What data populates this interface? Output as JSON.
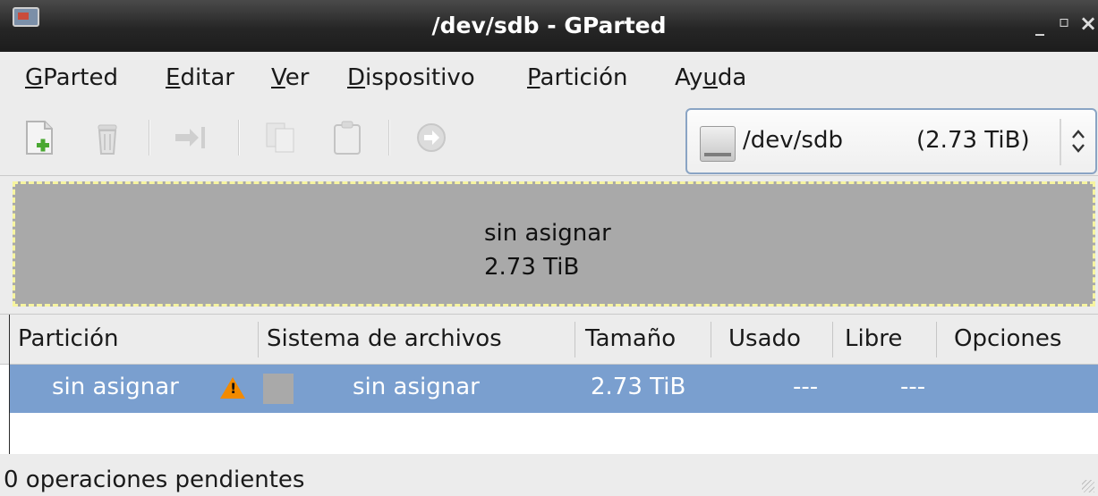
{
  "window": {
    "title": "/dev/sdb - GParted",
    "minimize_glyph": "_",
    "maximize_glyph": "▫",
    "close_glyph": "×"
  },
  "menu": [
    {
      "label": "GParted",
      "mnemonic": "G",
      "rest": "Parted"
    },
    {
      "label": "Editar",
      "mnemonic": "E",
      "rest": "ditar"
    },
    {
      "label": "Ver",
      "mnemonic": "V",
      "rest": "er"
    },
    {
      "label": "Dispositivo",
      "mnemonic": "D",
      "rest": "ispositivo"
    },
    {
      "label": "Partición",
      "mnemonic": "P",
      "rest": "artición"
    },
    {
      "label": "Ayuda",
      "pre": "Ay",
      "mnemonic": "u",
      "rest": "da"
    }
  ],
  "toolbar": {
    "icons": [
      "new-partition-icon",
      "delete-partition-icon",
      "resize-move-icon",
      "copy-icon",
      "paste-icon",
      "apply-icon"
    ],
    "device_selector": {
      "path": "/dev/sdb",
      "size": "(2.73 TiB)",
      "icon": "hard-disk-icon"
    }
  },
  "diskmap": {
    "label": "sin asignar",
    "size": "2.73 TiB",
    "color": "#a9a9a9",
    "border_color": "#f6f4a0"
  },
  "table": {
    "columns": [
      "Partición",
      "Sistema de archivos",
      "Tamaño",
      "Usado",
      "Libre",
      "Opciones"
    ],
    "rows": [
      {
        "partition": "sin asignar",
        "filesystem": "sin asignar",
        "size": "2.73 TiB",
        "used": "---",
        "free": "---",
        "flags": "",
        "warning": "!",
        "fs_color": "#a9a9a9"
      }
    ],
    "selection_color": "#7a9fcf"
  },
  "status": {
    "text": "0 operaciones pendientes"
  }
}
